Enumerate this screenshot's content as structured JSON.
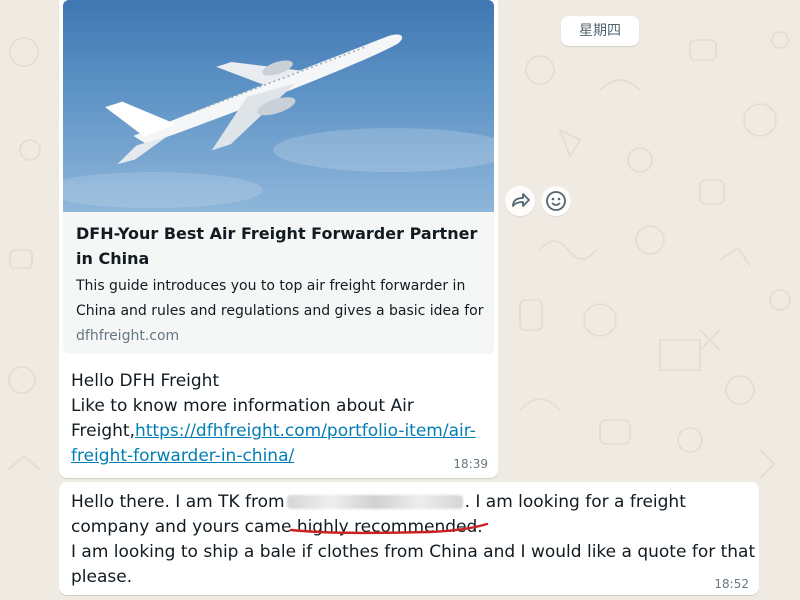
{
  "date_separator": "星期四",
  "messages": [
    {
      "link_preview": {
        "image_icon": "airplane-photo",
        "title": "DFH-Your Best Air Freight Forwarder Partner in China",
        "description_line_1": "This guide introduces you to top air freight forwarder in",
        "description_line_2": "China and rules and regulations and gives a basic idea for",
        "domain": "dfhfreight.com"
      },
      "text_line_1": "Hello DFH Freight",
      "text_line_2": "Like to know more information about Air",
      "text_line_3_prefix": "Freight,",
      "link_part_1": "https://dfhfreight.com/portfolio-item/air-",
      "link_part_2": "freight-forwarder-in-china/",
      "time": "18:39"
    },
    {
      "text_line_1_a": "Hello there. I am TK from",
      "text_line_1_b": ". I am looking for a freight",
      "text_line_2": "company and yours came highly recommended.",
      "text_line_3": "I am looking to ship a bale if clothes from China and I would like a quote for that",
      "text_line_4": "please.",
      "time": "18:52"
    }
  ],
  "actions": {
    "forward_icon": "forward-icon",
    "emoji_icon": "emoji-icon"
  },
  "colors": {
    "background": "#efeae2",
    "bubble": "#ffffff",
    "link": "#027eb5",
    "annotation_red": "#cc2222"
  }
}
